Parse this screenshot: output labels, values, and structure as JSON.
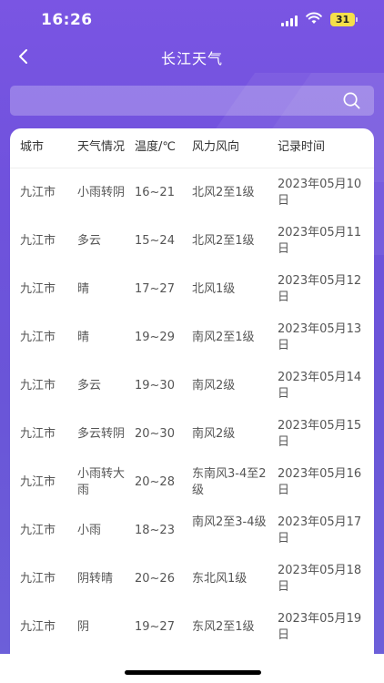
{
  "status_bar": {
    "time": "16:26",
    "battery": "31"
  },
  "nav": {
    "title": "长江天气"
  },
  "search": {
    "value": "",
    "placeholder": ""
  },
  "table": {
    "headers": {
      "city": "城市",
      "weather": "天气情况",
      "temp": "温度/℃",
      "wind": "风力风向",
      "time": "记录时间"
    },
    "rows": [
      {
        "city": "九江市",
        "weather": "小雨转阴",
        "temp": "16~21",
        "wind": "北风2至1级",
        "time": "2023年05月10日"
      },
      {
        "city": "九江市",
        "weather": "多云",
        "temp": "15~24",
        "wind": "北风2至1级",
        "time": "2023年05月11日"
      },
      {
        "city": "九江市",
        "weather": "晴",
        "temp": "17~27",
        "wind": "北风1级",
        "time": "2023年05月12日"
      },
      {
        "city": "九江市",
        "weather": "晴",
        "temp": "19~29",
        "wind": "南风2至1级",
        "time": "2023年05月13日"
      },
      {
        "city": "九江市",
        "weather": "多云",
        "temp": "19~30",
        "wind": "南风2级",
        "time": "2023年05月14日"
      },
      {
        "city": "九江市",
        "weather": "多云转阴",
        "temp": "20~30",
        "wind": "南风2级",
        "time": "2023年05月15日"
      },
      {
        "city": "九江市",
        "weather": "小雨转大雨",
        "temp": "20~28",
        "wind": "东南风3-4至2级",
        "time": "2023年05月16日"
      },
      {
        "city": "九江市",
        "weather": "小雨",
        "temp": "18~23",
        "wind": "南风2至3-4级",
        "time": "2023年05月17日"
      },
      {
        "city": "九江市",
        "weather": "阴转晴",
        "temp": "20~26",
        "wind": "东北风1级",
        "time": "2023年05月18日"
      },
      {
        "city": "九江市",
        "weather": "阴",
        "temp": "19~27",
        "wind": "东风2至1级",
        "time": "2023年05月19日"
      }
    ]
  },
  "icons": {
    "back": "chevron-left-icon",
    "search": "search-icon"
  },
  "colors": {
    "accent": "#7a55e3",
    "text": "#555555",
    "battery": "#f5e04a"
  }
}
